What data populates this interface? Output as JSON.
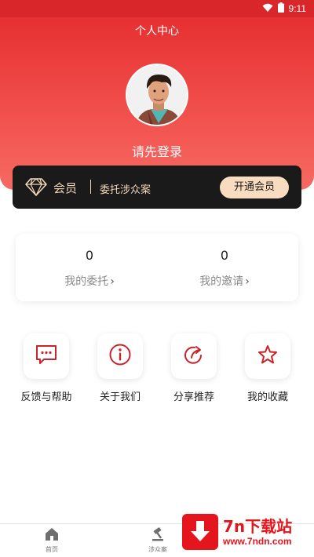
{
  "status_bar": {
    "time": "9:11",
    "icons": [
      "wifi-icon",
      "battery-icon"
    ]
  },
  "header": {
    "title": "个人中心",
    "login_prompt": "请先登录"
  },
  "membership": {
    "label": "会员",
    "description": "委托涉众案",
    "button_label": "开通会员",
    "icon": "diamond-icon"
  },
  "stats": [
    {
      "value": "0",
      "label": "我的委托"
    },
    {
      "value": "0",
      "label": "我的邀请"
    }
  ],
  "actions": [
    {
      "label": "反馈与帮助",
      "icon": "message-icon"
    },
    {
      "label": "关于我们",
      "icon": "info-icon"
    },
    {
      "label": "分享推荐",
      "icon": "share-icon"
    },
    {
      "label": "我的收藏",
      "icon": "star-icon"
    }
  ],
  "tabbar": [
    {
      "label": "首页",
      "icon": "home-icon"
    },
    {
      "label": "涉众案",
      "icon": "gavel-icon"
    }
  ],
  "watermark": {
    "title": "7n下载站",
    "url": "www.7ndn.com"
  },
  "colors": {
    "primary_red": "#e42a2c",
    "member_bg": "#1a1a1a",
    "member_gold": "#f3d8b8",
    "icon_red": "#c8252a"
  }
}
